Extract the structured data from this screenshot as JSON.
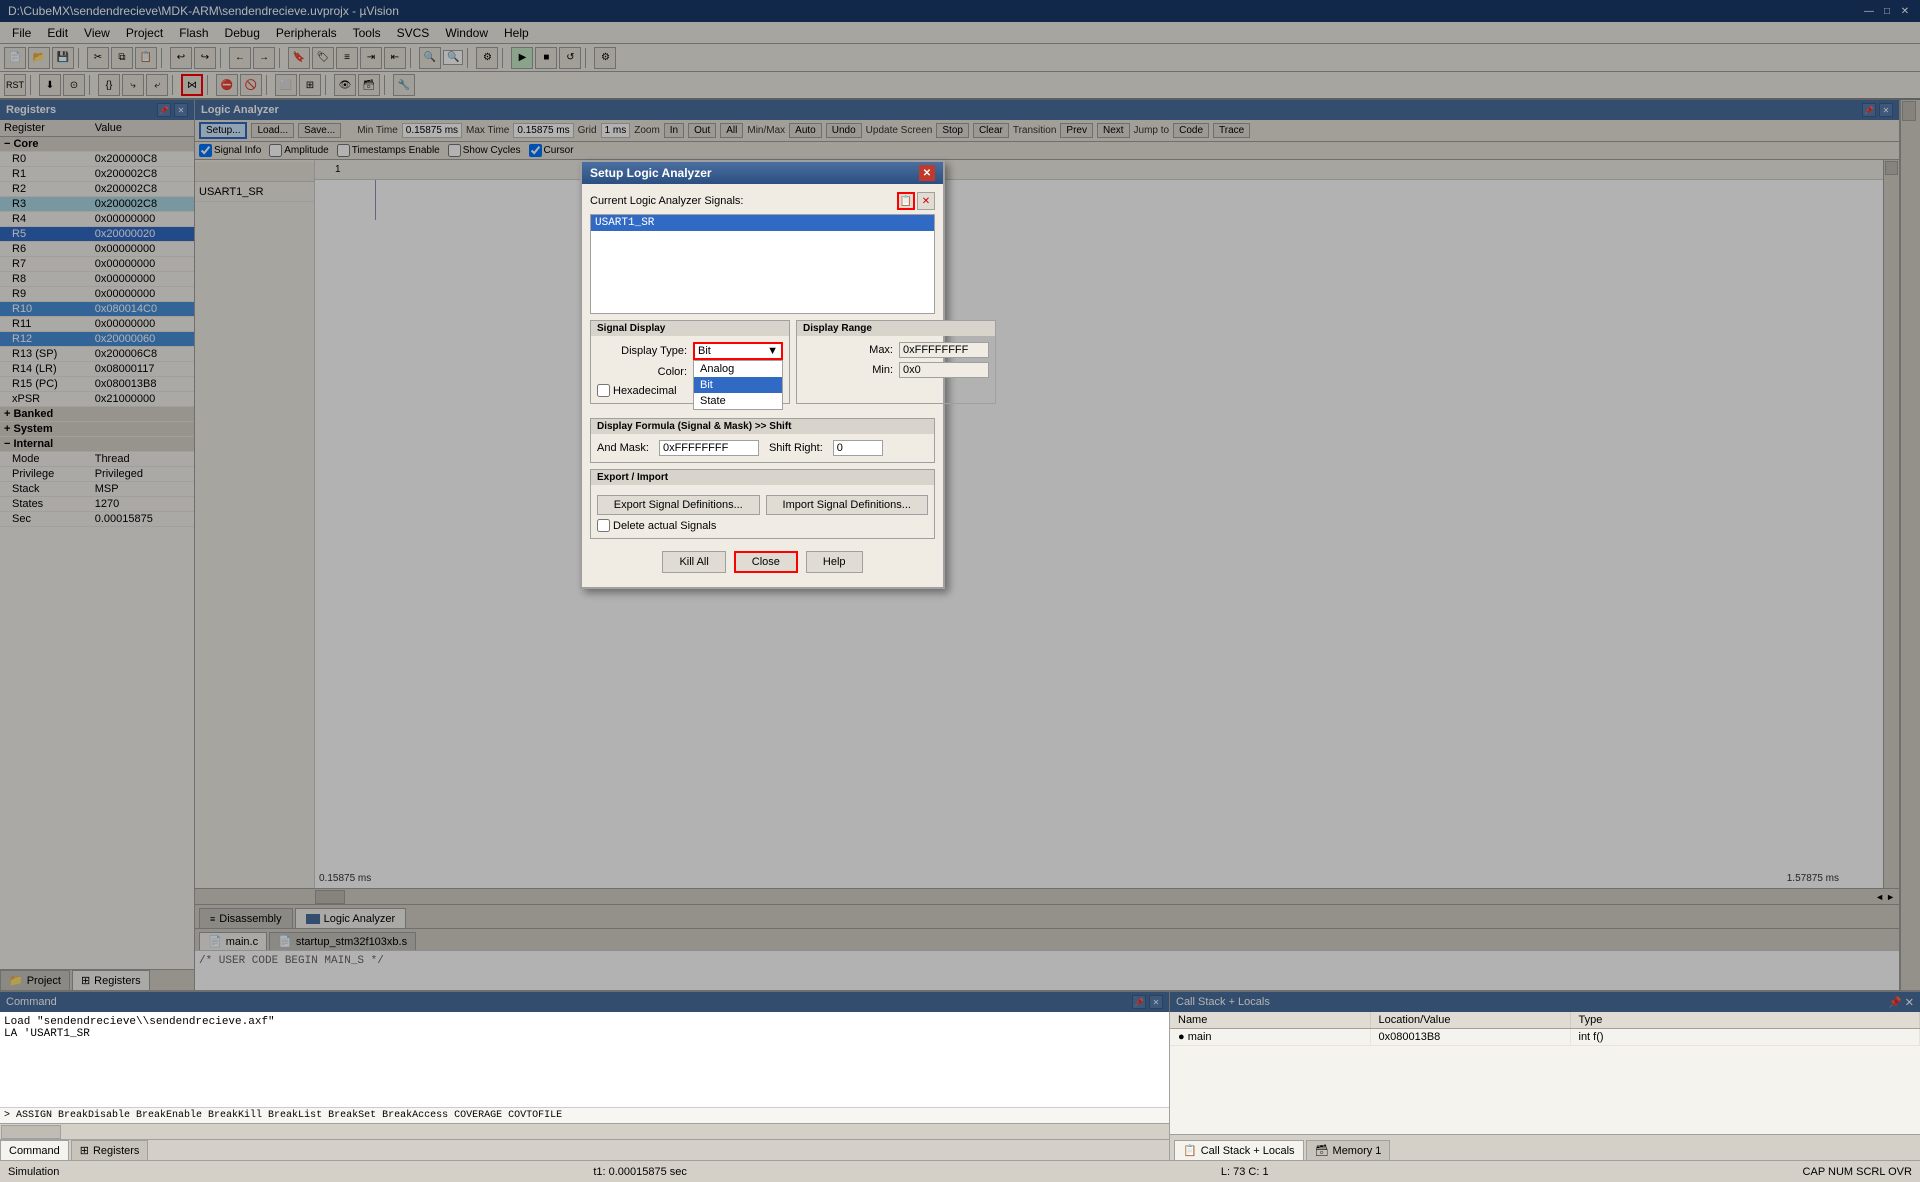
{
  "title_bar": {
    "text": "D:\\CubeMX\\sendendrecieve\\MDK-ARM\\sendendrecieve.uvprojx - µVision",
    "controls": [
      "—",
      "□",
      "✕"
    ]
  },
  "menu": {
    "items": [
      "File",
      "Edit",
      "View",
      "Project",
      "Flash",
      "Debug",
      "Peripherals",
      "Tools",
      "SVCS",
      "Window",
      "Help"
    ]
  },
  "registers": {
    "title": "Registers",
    "columns": [
      "Register",
      "Value"
    ],
    "groups": [
      {
        "name": "Core",
        "registers": [
          {
            "name": "R0",
            "value": "0x200000C8",
            "highlight": false,
            "selected": false
          },
          {
            "name": "R1",
            "value": "0x200002C8",
            "highlight": false,
            "selected": false
          },
          {
            "name": "R2",
            "value": "0x200002C8",
            "highlight": false,
            "selected": false
          },
          {
            "name": "R3",
            "value": "0x200002C8",
            "highlight": true,
            "selected": false
          },
          {
            "name": "R4",
            "value": "0x00000000",
            "highlight": false,
            "selected": false
          },
          {
            "name": "R5",
            "value": "0x20000020",
            "highlight": false,
            "selected": true
          },
          {
            "name": "R6",
            "value": "0x00000000",
            "highlight": false,
            "selected": false
          },
          {
            "name": "R7",
            "value": "0x00000000",
            "highlight": false,
            "selected": false
          },
          {
            "name": "R8",
            "value": "0x00000000",
            "highlight": false,
            "selected": false
          },
          {
            "name": "R9",
            "value": "0x00000000",
            "highlight": false,
            "selected": false
          },
          {
            "name": "R10",
            "value": "0x080014C0",
            "highlight": false,
            "selected": true
          },
          {
            "name": "R11",
            "value": "0x00000000",
            "highlight": false,
            "selected": false
          },
          {
            "name": "R12",
            "value": "0x20000060",
            "highlight": false,
            "selected": true
          },
          {
            "name": "R13 (SP)",
            "value": "0x200006C8",
            "highlight": false,
            "selected": false
          },
          {
            "name": "R14 (LR)",
            "value": "0x08000117",
            "highlight": false,
            "selected": false
          },
          {
            "name": "R15 (PC)",
            "value": "0x080013B8",
            "highlight": false,
            "selected": false
          },
          {
            "name": "xPSR",
            "value": "0x21000000",
            "highlight": false,
            "selected": false
          }
        ]
      },
      {
        "name": "Banked",
        "registers": []
      },
      {
        "name": "System",
        "registers": []
      },
      {
        "name": "Internal",
        "registers": [
          {
            "name": "Mode",
            "value": "Thread",
            "highlight": false,
            "selected": false
          },
          {
            "name": "Privilege",
            "value": "Privileged",
            "highlight": false,
            "selected": false
          },
          {
            "name": "Stack",
            "value": "MSP",
            "highlight": false,
            "selected": false
          },
          {
            "name": "States",
            "value": "1270",
            "highlight": false,
            "selected": false
          },
          {
            "name": "Sec",
            "value": "0.00015875",
            "highlight": false,
            "selected": false
          }
        ]
      }
    ]
  },
  "logic_analyzer": {
    "panel_title": "Logic Analyzer",
    "toolbar": {
      "setup_label": "Setup...",
      "load_label": "Load...",
      "save_label": "Save...",
      "min_time_label": "Min Time",
      "min_time_value": "0.15875 ms",
      "max_time_label": "Max Time",
      "max_time_value": "0.15875 ms",
      "grid_label": "Grid",
      "grid_value": "1 ms",
      "zoom_label": "Zoom",
      "zoom_in": "In",
      "zoom_out": "Out",
      "zoom_all": "All",
      "minmax_label": "Min/Max",
      "minmax_auto": "Auto",
      "minmax_undo": "Undo",
      "update_screen_label": "Update Screen",
      "update_stop": "Stop",
      "update_clear": "Clear",
      "transition_label": "Transition",
      "transition_prev": "Prev",
      "transition_next": "Next",
      "jump_to_label": "Jump to",
      "jump_code": "Code",
      "jump_trace": "Trace",
      "signal_info_label": "Signal Info",
      "show_cycles_label": "Show Cycles",
      "amplitude_label": "Amplitude",
      "timestamps_label": "Timestamps Enable",
      "cursor_label": "Cursor"
    },
    "signal_name": "USART1_SR",
    "time_markers": [
      "0.15875 ms",
      "1.57875 ms"
    ],
    "time_value": "1"
  },
  "setup_dialog": {
    "title": "Setup Logic Analyzer",
    "current_signals_label": "Current Logic Analyzer Signals:",
    "signals": [
      "USART1_SR"
    ],
    "selected_signal": "USART1_SR",
    "signal_display": {
      "title": "Signal Display",
      "display_type_label": "Display Type:",
      "display_type_value": "Bit",
      "display_options": [
        "Analog",
        "Bit",
        "State"
      ],
      "color_label": "Color:",
      "hexadecimal_label": "Hexadecimal"
    },
    "display_range": {
      "title": "Display Range",
      "max_label": "Max:",
      "max_value": "0xFFFFFFFF",
      "min_label": "Min:",
      "min_value": "0x0"
    },
    "display_formula": {
      "title": "Display Formula (Signal & Mask) >> Shift",
      "and_mask_label": "And Mask:",
      "and_mask_value": "0xFFFFFFFF",
      "shift_right_label": "Shift Right:",
      "shift_right_value": "0"
    },
    "export_import": {
      "title": "Export / Import",
      "export_btn": "Export Signal Definitions...",
      "import_btn": "Import Signal Definitions...",
      "delete_label": "Delete actual Signals"
    },
    "buttons": {
      "kill_all": "Kill All",
      "close": "Close",
      "help": "Help"
    }
  },
  "command_panel": {
    "title": "Command",
    "lines": [
      "Load \"sendendrecieve\\\\sendendrecieve.axf\"",
      "LA 'USART1_SR"
    ],
    "prompt_line": "ASSIGN BreakDisable BreakEnable BreakKill BreakList BreakSet BreakAccess COVERAGE COVTOFILE"
  },
  "callstack_panel": {
    "title": "Call Stack + Locals",
    "columns": [
      "Name",
      "Location/Value",
      "Type"
    ],
    "rows": [
      {
        "name": "● main",
        "location": "0x080013B8",
        "type": "int f()"
      }
    ]
  },
  "bottom_tabs": {
    "command": {
      "label": "Command",
      "active": true
    },
    "registers": {
      "label": "Registers"
    }
  },
  "panel_tabs": {
    "callstack": {
      "label": "Call Stack + Locals",
      "active": true
    },
    "memory1": {
      "label": "Memory 1"
    }
  },
  "file_tabs": {
    "main_c": "main.c",
    "startup": "startup_stm32f103xb.s"
  },
  "status_bar": {
    "left": "Simulation",
    "middle": "t1: 0.00015875 sec",
    "right": "L: 73 C: 1",
    "mode": "CAP NUM SCRL OVR"
  },
  "icons": {
    "folder": "📁",
    "save": "💾",
    "new": "📄",
    "debug": "🐛",
    "play": "▶",
    "stop": "■",
    "step": "→"
  }
}
